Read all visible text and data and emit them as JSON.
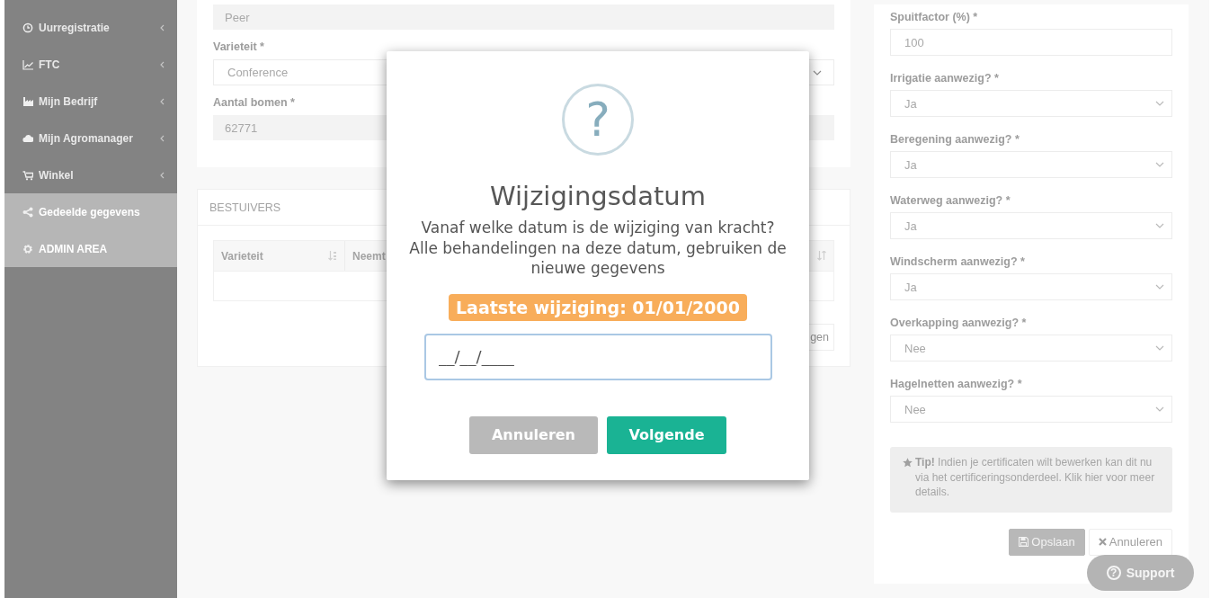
{
  "sidebar": {
    "items": [
      {
        "label": "Uurregistratie",
        "expandable": true,
        "selected": false
      },
      {
        "label": "FTC",
        "expandable": true,
        "selected": false
      },
      {
        "label": "Mijn Bedrijf",
        "expandable": true,
        "selected": false
      },
      {
        "label": "Mijn Agromanager",
        "expandable": true,
        "selected": false
      },
      {
        "label": "Winkel",
        "expandable": true,
        "selected": false
      },
      {
        "label": "Gedeelde gegevens",
        "expandable": false,
        "selected": true
      },
      {
        "label": "ADMIN AREA",
        "expandable": false,
        "selected": true
      }
    ]
  },
  "main_form": {
    "fields": [
      {
        "kind": "readonly",
        "value": "Peer"
      },
      {
        "kind": "select",
        "label": "Varieteit *",
        "value": "Conference"
      },
      {
        "kind": "readonly",
        "label": "Aantal bomen *",
        "value": "62771"
      }
    ]
  },
  "bestuivers": {
    "title": "BESTUIVERS",
    "columns": [
      "Varieteit",
      "Neemt"
    ],
    "button": "gen"
  },
  "right_form": {
    "fields": [
      {
        "kind": "input",
        "label": "Spuitfactor (%) *",
        "value": "100"
      },
      {
        "kind": "select",
        "label": "Irrigatie aanwezig? *",
        "value": "Ja"
      },
      {
        "kind": "select",
        "label": "Beregening aanwezig? *",
        "value": "Ja"
      },
      {
        "kind": "select",
        "label": "Waterweg aanwezig? *",
        "value": "Ja"
      },
      {
        "kind": "select",
        "label": "Windscherm aanwezig? *",
        "value": "Ja"
      },
      {
        "kind": "select",
        "label": "Overkapping aanwezig? *",
        "value": "Nee"
      },
      {
        "kind": "select",
        "label": "Hagelnetten aanwezig? *",
        "value": "Nee"
      }
    ],
    "tip": "**Tip!** Indien je certificaten wilt bewerken kan dit nu via het certificeringsonderdeel. Klik hier voor meer details.",
    "buttons": [
      {
        "kind": "save",
        "label": "Opslaan"
      },
      {
        "kind": "cancel",
        "label": "Annuleren"
      }
    ]
  },
  "support_button": {
    "icon_glyph": "?",
    "label": "Support"
  },
  "dialog": {
    "icon_glyph": "?",
    "title": "Wijzigingsdatum",
    "message": "Vanaf welke datum is de wijziging van kracht? Alle behandelingen na deze datum, gebruiken de nieuwe gegevens",
    "badge": "Laatste wijziging: 01/01/2000",
    "date_value": "__/__/____",
    "buttons": [
      {
        "kind": "cancel",
        "label": "Annuleren"
      },
      {
        "kind": "confirm",
        "label": "Volgende"
      }
    ]
  }
}
